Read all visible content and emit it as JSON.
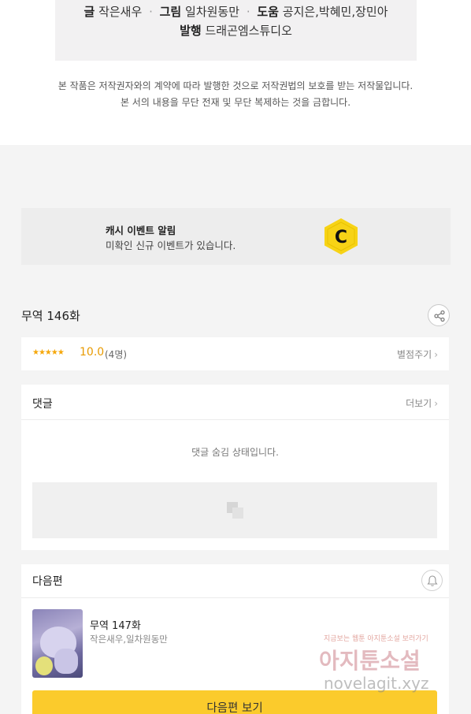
{
  "credits": {
    "writer_label": "글",
    "writer": "작은새우",
    "artist_label": "그림",
    "artist": "일차원동만",
    "assist_label": "도움",
    "assist": "공지은,박혜민,장민아",
    "publisher_label": "발행",
    "publisher": "드래곤엠스튜디오",
    "separator": "·"
  },
  "copyright": {
    "line1": "본 작품은 저작권자와의 계약에 따라 발행한 것으로 저작권법의 보호를 받는 저작물입니다.",
    "line2": "본 서의 내용을 무단 전재 및 무단 복제하는 것을 금합니다."
  },
  "cash_event": {
    "title": "캐시 이벤트 알림",
    "desc": "미확인 신규 이벤트가 있습니다.",
    "logo_letter": "C",
    "logo_color": "#f7d316"
  },
  "episode": {
    "title": "무역 146화"
  },
  "rating": {
    "stars": "★★★★★",
    "score": "10.0",
    "count": "(4명)",
    "action": "별점주기"
  },
  "comments": {
    "label": "댓글",
    "more": "더보기",
    "hidden_msg": "댓글 숨김 상태입니다."
  },
  "next": {
    "label": "다음편",
    "episode_title": "무역 147화",
    "authors": "작은새우,일차원동만",
    "button": "다음편 보기",
    "button_color": "#fbcb2c"
  },
  "watermark": {
    "small": "지금보는 웹툰 아지툰소설 보러가기",
    "big": "아지툰소설",
    "url": "novelagit.xyz"
  }
}
